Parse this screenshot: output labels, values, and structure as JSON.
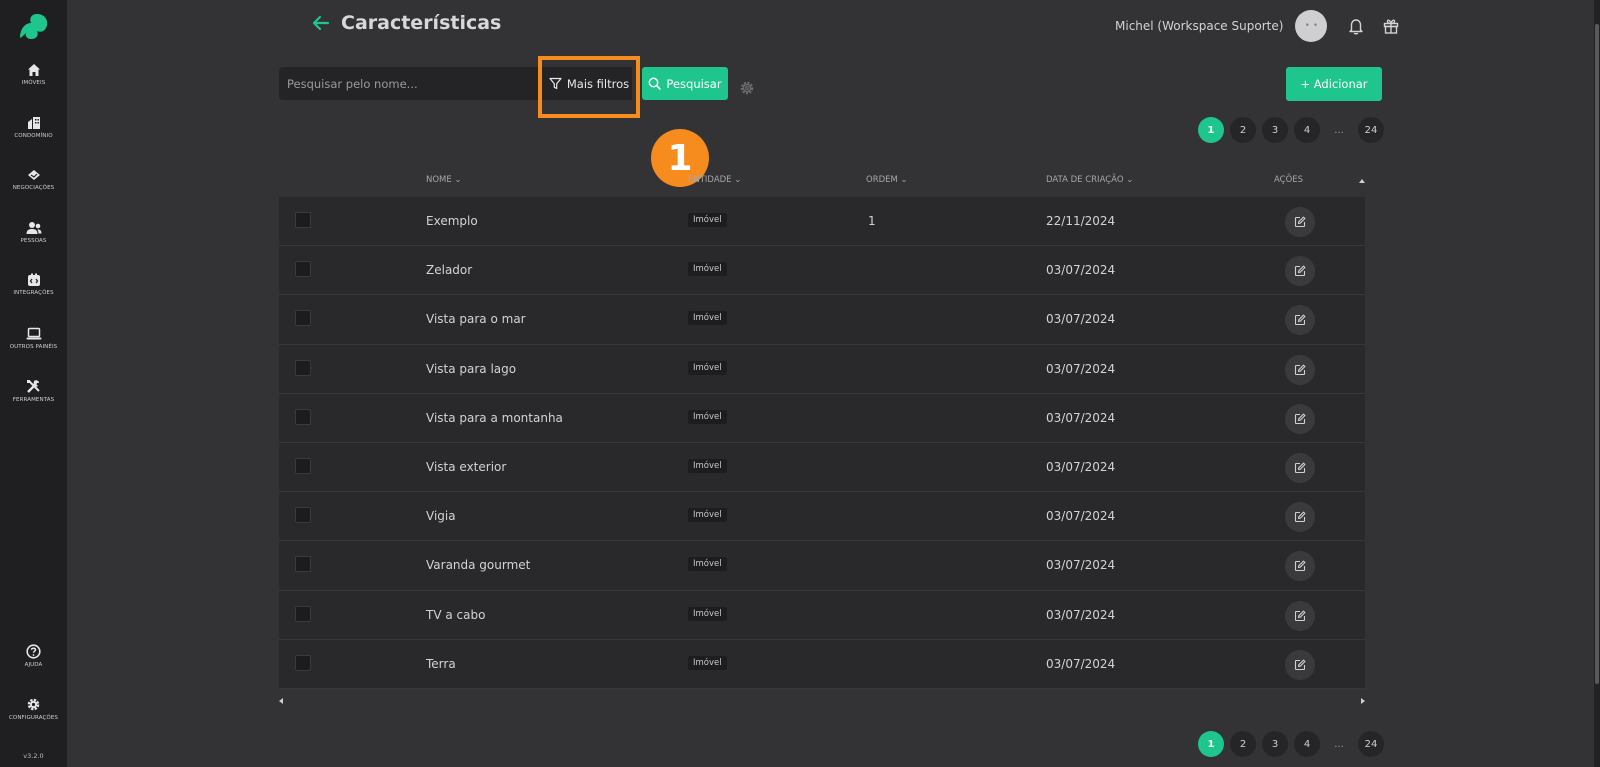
{
  "sidebar": {
    "items": [
      {
        "label": "Imóveis",
        "icon": "home-icon"
      },
      {
        "label": "Condomínio",
        "icon": "building-icon"
      },
      {
        "label": "Negociações",
        "icon": "handshake-icon"
      },
      {
        "label": "Pessoas",
        "icon": "people-icon"
      },
      {
        "label": "Integrações",
        "icon": "integration-icon"
      },
      {
        "label": "Outros Painéis",
        "icon": "laptop-icon"
      },
      {
        "label": "Ferramentas",
        "icon": "tools-icon"
      }
    ],
    "help_label": "Ajuda",
    "settings_label": "Configurações",
    "version": "v3.2.0"
  },
  "header": {
    "title": "Características",
    "user_name": "Michel (Workspace Suporte)"
  },
  "toolbar": {
    "search_placeholder": "Pesquisar pelo nome...",
    "filters_label": "Mais filtros",
    "search_label": "Pesquisar",
    "add_label": "+ Adicionar"
  },
  "step_marker": "1",
  "pagination": {
    "pages": [
      "1",
      "2",
      "3",
      "4"
    ],
    "ellipsis": "...",
    "last": "24",
    "current": "1"
  },
  "table": {
    "columns": {
      "name": "Nome",
      "entity": "Entidade",
      "order": "Ordem",
      "created": "Data de criação",
      "actions": "Ações"
    },
    "rows": [
      {
        "name": "Exemplo",
        "entity": "Imóvel",
        "order": "1",
        "date": "22/11/2024"
      },
      {
        "name": "Zelador",
        "entity": "Imóvel",
        "order": "",
        "date": "03/07/2024"
      },
      {
        "name": "Vista para o mar",
        "entity": "Imóvel",
        "order": "",
        "date": "03/07/2024"
      },
      {
        "name": "Vista para lago",
        "entity": "Imóvel",
        "order": "",
        "date": "03/07/2024"
      },
      {
        "name": "Vista para a montanha",
        "entity": "Imóvel",
        "order": "",
        "date": "03/07/2024"
      },
      {
        "name": "Vista exterior",
        "entity": "Imóvel",
        "order": "",
        "date": "03/07/2024"
      },
      {
        "name": "Vigia",
        "entity": "Imóvel",
        "order": "",
        "date": "03/07/2024"
      },
      {
        "name": "Varanda gourmet",
        "entity": "Imóvel",
        "order": "",
        "date": "03/07/2024"
      },
      {
        "name": "TV a cabo",
        "entity": "Imóvel",
        "order": "",
        "date": "03/07/2024"
      },
      {
        "name": "Terra",
        "entity": "Imóvel",
        "order": "",
        "date": "03/07/2024"
      }
    ]
  },
  "colors": {
    "accent": "#1ec58c",
    "highlight": "#f68b1e",
    "background": "#333335",
    "sidebar": "#1f1f21"
  }
}
